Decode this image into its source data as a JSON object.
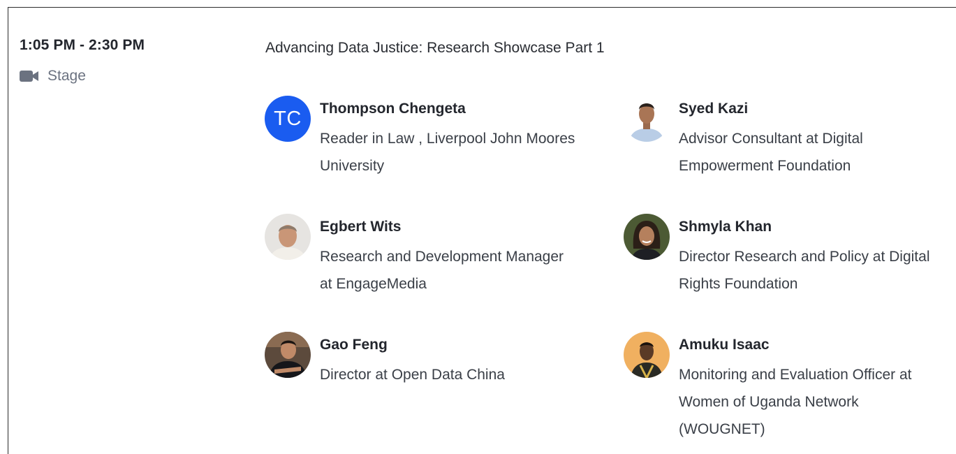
{
  "session": {
    "time": "1:05 PM - 2:30 PM",
    "location": "Stage",
    "location_icon": "video-camera-icon",
    "title": "Advancing Data Justice: Research Showcase Part 1"
  },
  "speakers": [
    {
      "initials": "TC",
      "name": "Thompson Chengeta",
      "role": "Reader in Law , Liverpool John Moores University"
    },
    {
      "name": "Syed Kazi",
      "role": "Advisor Consultant at Digital Empowerment Foundation"
    },
    {
      "name": "Egbert Wits",
      "role": "Research and Development Manager at EngageMedia"
    },
    {
      "name": "Shmyla Khan",
      "role": "Director Research and Policy at Digital Rights Foundation"
    },
    {
      "name": "Gao Feng",
      "role": "Director at Open Data China"
    },
    {
      "name": "Amuku Isaac",
      "role": "Monitoring and Evaluation Officer at Women of Uganda Network (WOUGNET)"
    }
  ],
  "colors": {
    "initials_avatar_bg": "#1a5cf0",
    "text_primary": "#23262d",
    "text_muted": "#6b7280"
  }
}
